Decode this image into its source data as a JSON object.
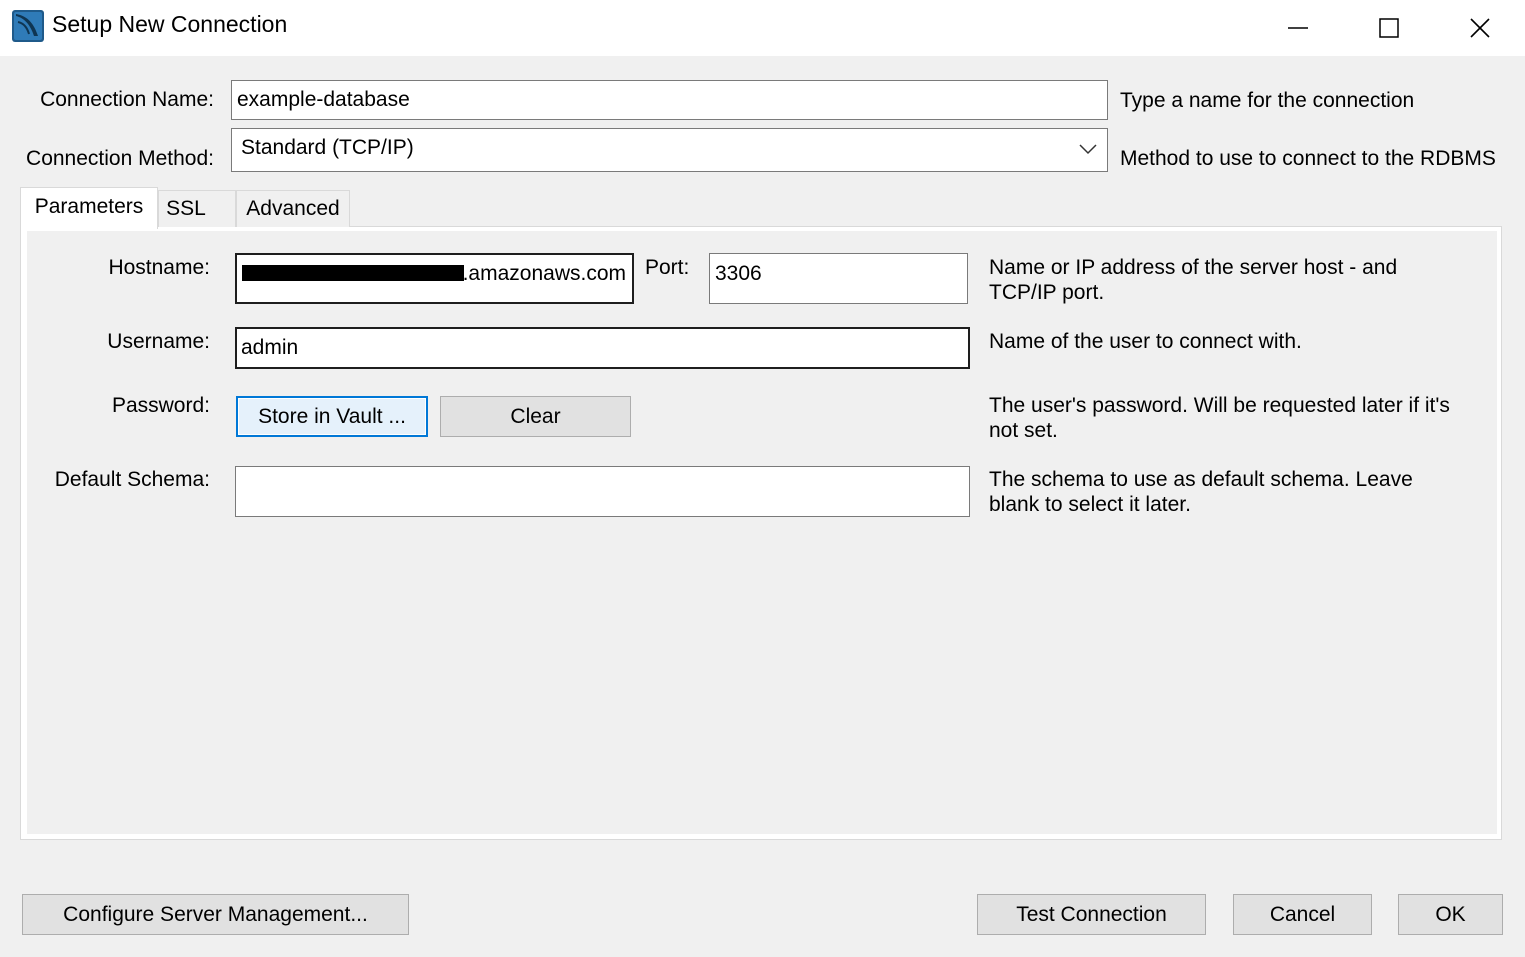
{
  "window": {
    "title": "Setup New Connection",
    "icon": "mysql-workbench-icon",
    "controls": [
      "minimize-icon",
      "maximize-icon",
      "close-icon"
    ]
  },
  "connection": {
    "name_label": "Connection Name:",
    "name_value": "example-database",
    "name_help": "Type a name for the connection",
    "method_label": "Connection Method:",
    "method_value": "Standard (TCP/IP)",
    "method_help": "Method to use to connect to the RDBMS"
  },
  "tabs": [
    {
      "label": "Parameters",
      "active": true
    },
    {
      "label": "SSL",
      "active": false
    },
    {
      "label": "Advanced",
      "active": false
    }
  ],
  "params": {
    "hostname_label": "Hostname:",
    "hostname_value": ".amazonaws.com",
    "port_label": "Port:",
    "port_value": "3306",
    "hostname_help_1": "Name or IP address of the server host - and",
    "hostname_help_2": "TCP/IP port.",
    "username_label": "Username:",
    "username_value": "admin",
    "username_help": "Name of the user to connect with.",
    "password_label": "Password:",
    "store_vault_label": "Store in Vault ...",
    "clear_label": "Clear",
    "password_help_1": "The user's password. Will be requested later if it's",
    "password_help_2": "not set.",
    "schema_label": "Default Schema:",
    "schema_value": "",
    "schema_help_1": "The schema to use as default schema. Leave",
    "schema_help_2": "blank to select it later."
  },
  "footer": {
    "configure_label": "Configure Server Management...",
    "test_label": "Test Connection",
    "cancel_label": "Cancel",
    "ok_label": "OK"
  }
}
